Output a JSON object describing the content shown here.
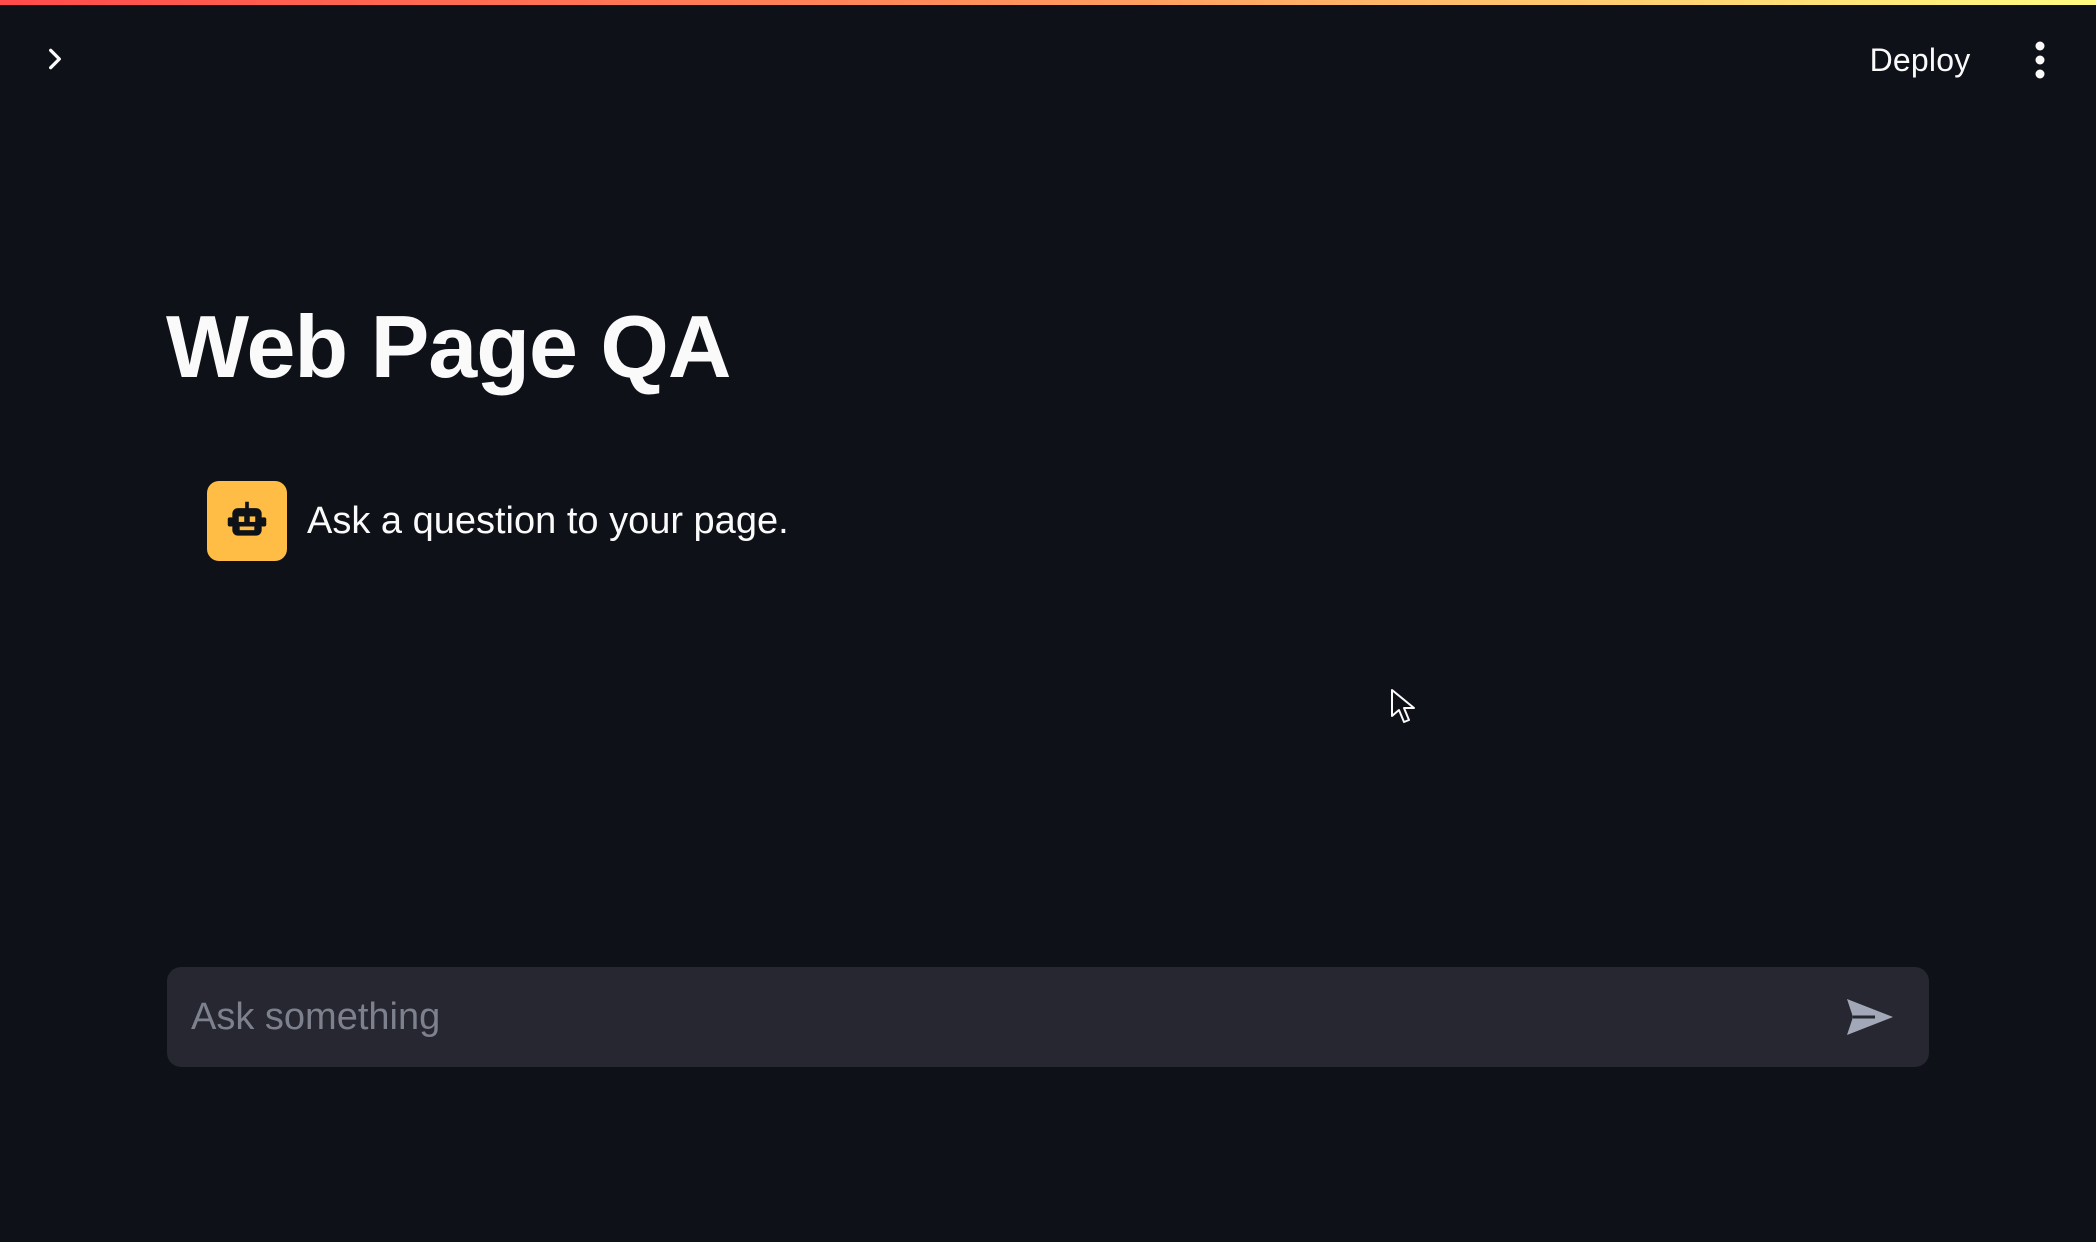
{
  "header": {
    "deploy_label": "Deploy",
    "sidebar_toggle_icon": "chevron-right-icon",
    "menu_icon": "more-vertical-icon"
  },
  "main": {
    "title": "Web Page QA",
    "messages": [
      {
        "role": "assistant",
        "avatar_icon": "robot-icon",
        "text": "Ask a question to your page."
      }
    ]
  },
  "chat_input": {
    "value": "",
    "placeholder": "Ask something",
    "send_icon": "send-icon"
  },
  "colors": {
    "background": "#0e1117",
    "input_background": "#262730",
    "avatar_background": "#ffbd45",
    "text": "#fafafa",
    "placeholder": "#7d808d",
    "top_stripe_start": "#ff4b4b",
    "top_stripe_end": "#fffd80"
  }
}
